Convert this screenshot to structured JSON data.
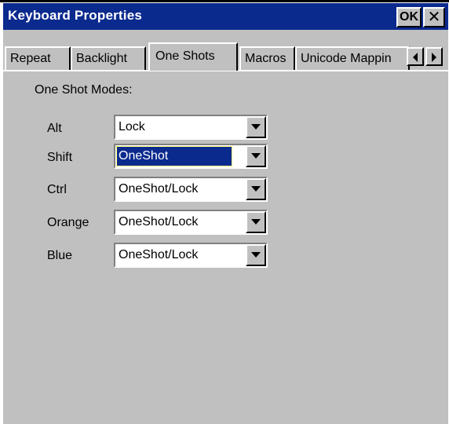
{
  "window": {
    "title": "Keyboard Properties",
    "ok_label": "OK",
    "close_glyph": "✕"
  },
  "tabs": [
    {
      "label": "Repeat",
      "active": false
    },
    {
      "label": "Backlight",
      "active": false
    },
    {
      "label": "One Shots",
      "active": true
    },
    {
      "label": "Macros",
      "active": false
    },
    {
      "label": "Unicode Mappin",
      "active": false
    }
  ],
  "tab_scroll": {
    "left_icon": "arrow-left-icon",
    "right_icon": "arrow-right-icon"
  },
  "section": {
    "heading": "One Shot Modes:"
  },
  "modes": [
    {
      "label": "Alt",
      "value": "Lock"
    },
    {
      "label": "Shift",
      "value": "OneShot",
      "focused": true
    },
    {
      "label": "Ctrl",
      "value": "OneShot/Lock"
    },
    {
      "label": "Orange",
      "value": "OneShot/Lock"
    },
    {
      "label": "Blue",
      "value": "OneShot/Lock"
    }
  ],
  "colors": {
    "titlebar": "#0b2a8e",
    "face": "#c0c0c0",
    "selection": "#0b2a8e"
  }
}
